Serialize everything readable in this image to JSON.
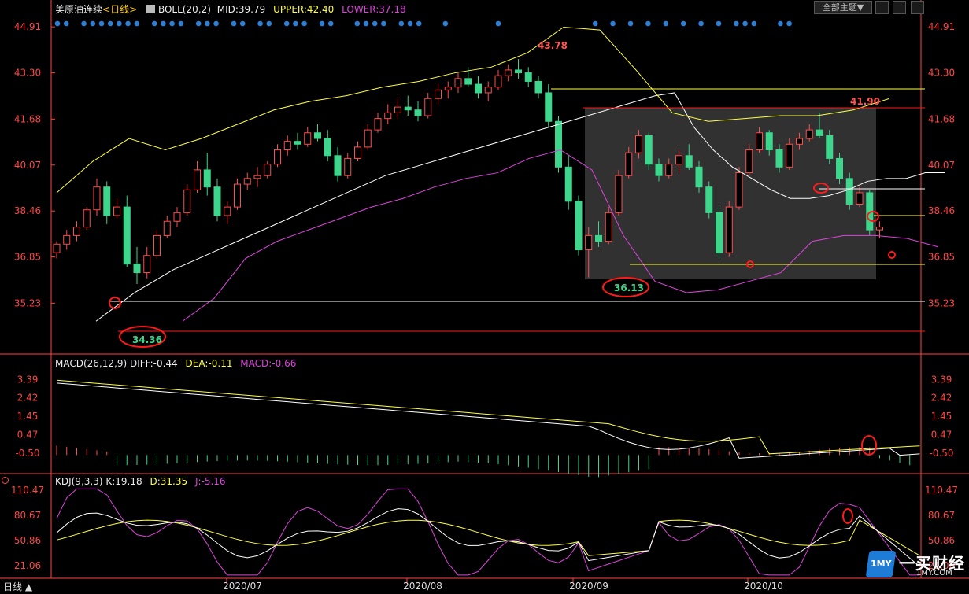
{
  "header": {
    "symbol": "美原油连续",
    "period": "<日线>",
    "boll": {
      "label": "BOLL(20,2)",
      "mid": "MID:39.79",
      "upper": "UPPER:42.40",
      "lower": "LOWER:37.18"
    },
    "theme_button": "全部主题▼"
  },
  "panels": {
    "price": {
      "yticks": [
        "44.91",
        "43.30",
        "41.68",
        "40.07",
        "38.46",
        "36.85",
        "35.23"
      ],
      "annotations": {
        "high": "43.78",
        "low": "34.36",
        "low2": "36.13",
        "recent_high": "41.90"
      }
    },
    "macd": {
      "label": "MACD(26,12,9)",
      "diff": "DIFF:-0.44",
      "dea": "DEA:-0.11",
      "macd": "MACD:-0.66",
      "yticks": [
        "3.39",
        "2.42",
        "1.45",
        "0.47",
        "-0.50"
      ]
    },
    "kdj": {
      "label": "KDJ(9,3,3)",
      "k": "K:19.18",
      "d": "D:31.35",
      "j": "J:-5.16",
      "yticks": [
        "110.47",
        "80.67",
        "50.86",
        "21.06"
      ]
    }
  },
  "xaxis": {
    "labels": [
      "2020/07",
      "2020/08",
      "2020/09",
      "2020/10"
    ]
  },
  "footer": {
    "tab": "日线 ▲"
  },
  "watermark": {
    "brand": "一买财经",
    "site": "1MY.COM",
    "logo": "1MY"
  },
  "colors": {
    "up": "#ff4d4d",
    "down": "#3dd68c",
    "mid": "#ffffff",
    "upper": "#ffff44",
    "lower": "#dd44dd",
    "axis": "#ff4444",
    "grid": "#333333",
    "mark": "#ff1a1a",
    "dot": "#2b7fd6"
  },
  "chart_data": {
    "type": "candlestick",
    "title": "美原油连续 <日线>",
    "ylim_price": [
      34.0,
      45.3
    ],
    "series": [
      {
        "name": "K",
        "values": [
          [
            37.0,
            37.4,
            36.8,
            37.3
          ],
          [
            37.3,
            37.8,
            37.1,
            37.6
          ],
          [
            37.6,
            38.1,
            37.4,
            37.9
          ],
          [
            37.9,
            38.6,
            37.8,
            38.5
          ],
          [
            38.5,
            39.6,
            38.3,
            39.3
          ],
          [
            39.3,
            39.5,
            38.0,
            38.3
          ],
          [
            38.3,
            38.9,
            38.2,
            38.6
          ],
          [
            38.6,
            39.0,
            36.5,
            36.6
          ],
          [
            36.6,
            37.2,
            35.9,
            36.3
          ],
          [
            36.3,
            37.2,
            36.1,
            36.9
          ],
          [
            36.9,
            37.8,
            36.8,
            37.6
          ],
          [
            37.6,
            38.3,
            37.5,
            38.1
          ],
          [
            38.1,
            38.6,
            37.9,
            38.4
          ],
          [
            38.4,
            39.4,
            38.3,
            39.2
          ],
          [
            39.2,
            40.2,
            39.1,
            39.9
          ],
          [
            39.9,
            40.5,
            39.0,
            39.3
          ],
          [
            39.3,
            39.6,
            38.1,
            38.3
          ],
          [
            38.3,
            38.8,
            38.0,
            38.6
          ],
          [
            38.6,
            39.6,
            38.5,
            39.4
          ],
          [
            39.4,
            39.8,
            39.2,
            39.6
          ],
          [
            39.6,
            40.0,
            39.3,
            39.7
          ],
          [
            39.7,
            40.2,
            39.6,
            40.1
          ],
          [
            40.1,
            40.8,
            40.0,
            40.6
          ],
          [
            40.6,
            41.1,
            40.4,
            40.9
          ],
          [
            40.9,
            41.2,
            40.6,
            40.8
          ],
          [
            40.8,
            41.4,
            40.7,
            41.2
          ],
          [
            41.2,
            41.5,
            40.9,
            41.0
          ],
          [
            41.0,
            41.3,
            40.2,
            40.4
          ],
          [
            40.4,
            40.7,
            39.5,
            39.7
          ],
          [
            39.7,
            40.5,
            39.6,
            40.3
          ],
          [
            40.3,
            40.9,
            40.2,
            40.7
          ],
          [
            40.7,
            41.5,
            40.6,
            41.3
          ],
          [
            41.3,
            41.9,
            41.2,
            41.7
          ],
          [
            41.7,
            42.2,
            41.5,
            41.9
          ],
          [
            41.9,
            42.4,
            41.7,
            42.1
          ],
          [
            42.1,
            42.5,
            41.8,
            42.0
          ],
          [
            42.0,
            42.3,
            41.6,
            41.8
          ],
          [
            41.8,
            42.6,
            41.7,
            42.4
          ],
          [
            42.4,
            42.9,
            42.2,
            42.7
          ],
          [
            42.7,
            43.0,
            42.4,
            42.8
          ],
          [
            42.8,
            43.3,
            42.6,
            43.1
          ],
          [
            43.1,
            43.5,
            42.8,
            42.9
          ],
          [
            42.9,
            43.2,
            42.4,
            42.6
          ],
          [
            42.6,
            43.0,
            42.3,
            42.8
          ],
          [
            42.8,
            43.4,
            42.7,
            43.2
          ],
          [
            43.2,
            43.6,
            43.0,
            43.4
          ],
          [
            43.4,
            43.78,
            43.1,
            43.3
          ],
          [
            43.3,
            43.5,
            42.8,
            43.0
          ],
          [
            43.0,
            43.2,
            42.4,
            42.6
          ],
          [
            42.6,
            42.9,
            41.4,
            41.6
          ],
          [
            41.6,
            41.8,
            39.8,
            40.0
          ],
          [
            40.0,
            40.4,
            38.5,
            38.8
          ],
          [
            38.8,
            39.0,
            36.9,
            37.1
          ],
          [
            37.1,
            37.9,
            36.13,
            37.6
          ],
          [
            37.6,
            38.1,
            37.2,
            37.4
          ],
          [
            37.4,
            38.6,
            37.3,
            38.4
          ],
          [
            38.4,
            39.9,
            38.3,
            39.7
          ],
          [
            39.7,
            40.7,
            39.6,
            40.5
          ],
          [
            40.5,
            41.3,
            40.3,
            41.1
          ],
          [
            41.1,
            41.2,
            39.9,
            40.1
          ],
          [
            40.1,
            40.3,
            39.5,
            39.7
          ],
          [
            39.7,
            40.3,
            39.6,
            40.1
          ],
          [
            40.1,
            40.6,
            39.8,
            40.4
          ],
          [
            40.4,
            40.8,
            39.9,
            40.0
          ],
          [
            40.0,
            40.2,
            39.1,
            39.3
          ],
          [
            39.3,
            39.5,
            38.2,
            38.4
          ],
          [
            38.4,
            38.6,
            36.8,
            37.0
          ],
          [
            37.0,
            38.8,
            36.85,
            38.6
          ],
          [
            38.6,
            40.0,
            38.5,
            39.8
          ],
          [
            39.8,
            40.8,
            39.7,
            40.6
          ],
          [
            40.6,
            41.4,
            40.5,
            41.2
          ],
          [
            41.2,
            41.3,
            40.4,
            40.6
          ],
          [
            40.6,
            40.8,
            39.8,
            40.0
          ],
          [
            40.0,
            41.0,
            39.9,
            40.8
          ],
          [
            40.8,
            41.2,
            40.6,
            41.0
          ],
          [
            41.0,
            41.5,
            40.9,
            41.3
          ],
          [
            41.3,
            41.9,
            41.0,
            41.1
          ],
          [
            41.1,
            41.3,
            40.1,
            40.3
          ],
          [
            40.3,
            40.5,
            39.4,
            39.6
          ],
          [
            39.6,
            39.8,
            38.5,
            38.7
          ],
          [
            38.7,
            39.3,
            38.6,
            39.1
          ],
          [
            39.1,
            39.2,
            37.6,
            37.8
          ],
          [
            37.8,
            38.1,
            37.5,
            37.9
          ]
        ]
      },
      {
        "name": "MID",
        "values": [
          34.6,
          35.1,
          35.6,
          36.0,
          36.4,
          36.7,
          37.0,
          37.3,
          37.6,
          37.9,
          38.2,
          38.5,
          38.8,
          39.1,
          39.4,
          39.7,
          39.9,
          40.1,
          40.3,
          40.5,
          40.7,
          40.9,
          41.1,
          41.3,
          41.5,
          41.7,
          41.9,
          42.1,
          42.3,
          42.5,
          42.6,
          41.4,
          40.6,
          40.0,
          39.6,
          39.2,
          38.9,
          38.9,
          39.0,
          39.2,
          39.5,
          39.6,
          39.6,
          39.8,
          39.8
        ]
      },
      {
        "name": "UPPER",
        "values": [
          39.1,
          40.2,
          41.0,
          40.6,
          41.0,
          41.5,
          42.0,
          42.3,
          42.5,
          42.8,
          43.0,
          43.3,
          43.5,
          44.0,
          44.9,
          44.8,
          43.4,
          41.9,
          41.6,
          41.7,
          41.8,
          41.8,
          42.0,
          42.4
        ]
      },
      {
        "name": "LOWER",
        "values": [
          34.6,
          35.4,
          36.8,
          37.4,
          37.8,
          38.2,
          38.6,
          38.9,
          39.3,
          39.6,
          39.8,
          40.3,
          40.6,
          39.9,
          37.6,
          36.0,
          35.6,
          35.7,
          36.0,
          36.3,
          37.4,
          37.6,
          37.6,
          37.5,
          37.2
        ]
      }
    ],
    "annotations": [
      "43.78",
      "41.90",
      "36.13",
      "34.36"
    ],
    "macd": {
      "yticks": [
        3.39,
        2.42,
        1.45,
        0.47,
        -0.5
      ],
      "diff": -0.44,
      "dea": -0.11,
      "macd": -0.66
    },
    "kdj": {
      "yticks": [
        110.47,
        80.67,
        50.86,
        21.06
      ],
      "k": 19.18,
      "d": 31.35,
      "j": -5.16
    },
    "xlabels": [
      "2020/07",
      "2020/08",
      "2020/09",
      "2020/10"
    ]
  }
}
